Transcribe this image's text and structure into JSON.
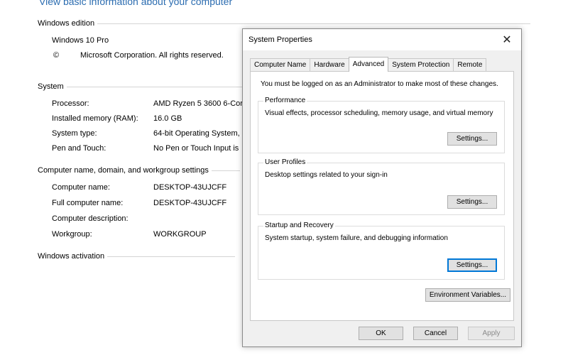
{
  "background": {
    "title": "View basic information about your computer",
    "windows_edition": {
      "header": "Windows edition",
      "edition": "Windows 10 Pro",
      "copyright_symbol": "©",
      "copyright": "Microsoft Corporation. All rights reserved."
    },
    "system": {
      "header": "System",
      "rows": [
        {
          "label": "Processor:",
          "value": "AMD Ryzen 5 3600 6-Cor"
        },
        {
          "label": "Installed memory (RAM):",
          "value": "16.0 GB"
        },
        {
          "label": "System type:",
          "value": "64-bit Operating System,"
        },
        {
          "label": "Pen and Touch:",
          "value": "No Pen or Touch Input is"
        }
      ]
    },
    "computer_name": {
      "header": "Computer name, domain, and workgroup settings",
      "rows": [
        {
          "label": "Computer name:",
          "value": "DESKTOP-43UJCFF"
        },
        {
          "label": "Full computer name:",
          "value": "DESKTOP-43UJCFF"
        },
        {
          "label": "Computer description:",
          "value": ""
        },
        {
          "label": "Workgroup:",
          "value": "WORKGROUP"
        }
      ]
    },
    "activation": {
      "header": "Windows activation"
    }
  },
  "dialog": {
    "title": "System Properties",
    "close_glyph": "✕",
    "tabs": [
      {
        "label": "Computer Name",
        "active": false
      },
      {
        "label": "Hardware",
        "active": false
      },
      {
        "label": "Advanced",
        "active": true
      },
      {
        "label": "System Protection",
        "active": false
      },
      {
        "label": "Remote",
        "active": false
      }
    ],
    "admin_note": "You must be logged on as an Administrator to make most of these changes.",
    "performance": {
      "label": "Performance",
      "description": "Visual effects, processor scheduling, memory usage, and virtual memory",
      "button": "Settings..."
    },
    "user_profiles": {
      "label": "User Profiles",
      "description": "Desktop settings related to your sign-in",
      "button": "Settings..."
    },
    "startup_recovery": {
      "label": "Startup and Recovery",
      "description": "System startup, system failure, and debugging information",
      "button": "Settings..."
    },
    "env_button": "Environment Variables...",
    "ok_button": "OK",
    "cancel_button": "Cancel",
    "apply_button": "Apply",
    "accent_color": "#0078d7"
  }
}
